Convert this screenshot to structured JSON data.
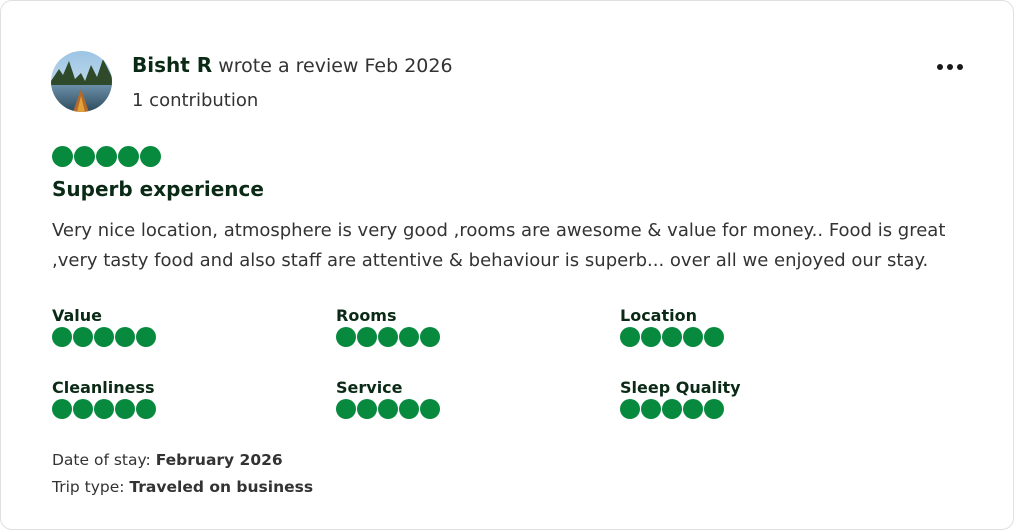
{
  "reviewer": {
    "name": "Bisht R",
    "action": "wrote a review Feb 2026",
    "contributions": "1 contribution"
  },
  "review": {
    "rating": 5,
    "title": "Superb experience",
    "text": "Very nice location, atmosphere is very good ,rooms are awesome & value for money.. Food is great ,very tasty food and also staff are attentive & behaviour is superb... over all we enjoyed our stay."
  },
  "subratings": [
    {
      "label": "Value",
      "rating": 5
    },
    {
      "label": "Rooms",
      "rating": 5
    },
    {
      "label": "Location",
      "rating": 5
    },
    {
      "label": "Cleanliness",
      "rating": 5
    },
    {
      "label": "Service",
      "rating": 5
    },
    {
      "label": "Sleep Quality",
      "rating": 5
    }
  ],
  "stay": {
    "date_label": "Date of stay:",
    "date_value": "February 2026",
    "trip_label": "Trip type:",
    "trip_value": "Traveled on business"
  },
  "colors": {
    "bubble": "#078a3e",
    "heading": "#0b2a16"
  },
  "icons": {
    "more": "more-options-icon",
    "avatar": "avatar-photo"
  }
}
